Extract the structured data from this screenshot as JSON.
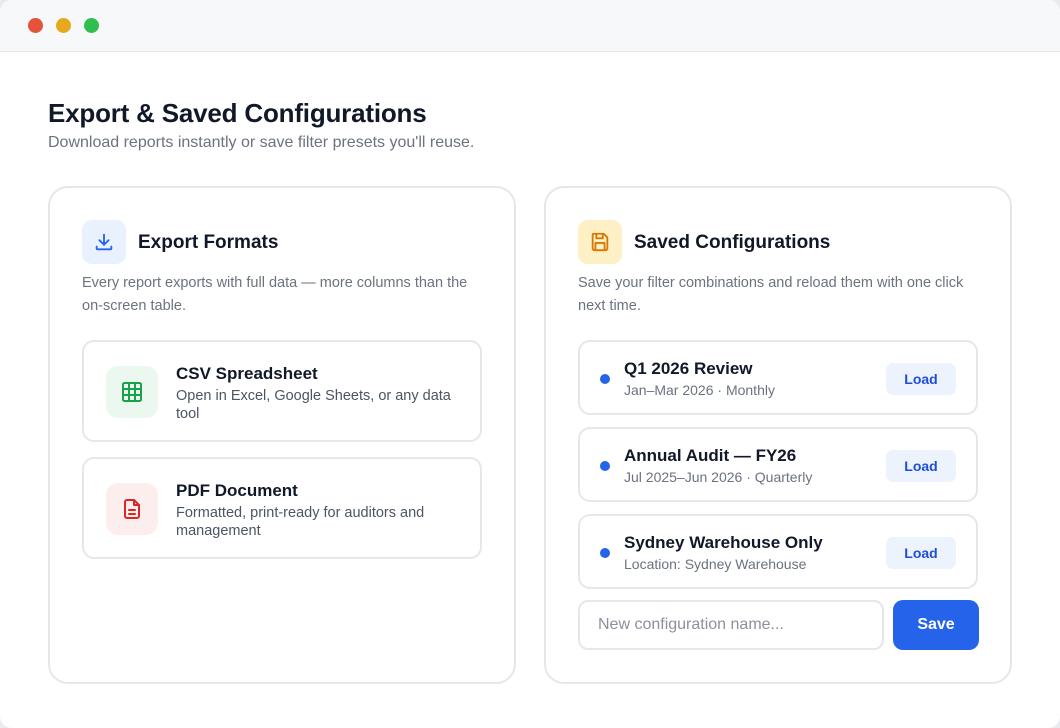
{
  "header": {
    "title": "Export & Saved Configurations",
    "subtitle": "Download reports instantly or save filter presets you'll reuse."
  },
  "export_card": {
    "icon": "download-icon",
    "title": "Export Formats",
    "description": "Every report exports with full data — more columns than the on-screen table.",
    "formats": [
      {
        "icon": "spreadsheet-grid-icon",
        "name": "CSV Spreadsheet",
        "description": "Open in Excel, Google Sheets, or any data tool",
        "accent": "#16a34a"
      },
      {
        "icon": "document-icon",
        "name": "PDF Document",
        "description": "Formatted, print-ready for auditors and management",
        "accent": "#dc2626"
      }
    ]
  },
  "saved_card": {
    "icon": "floppy-disk-icon",
    "title": "Saved Configurations",
    "description": "Save your filter combinations and reload them with one click next time.",
    "configs": [
      {
        "name": "Q1 2026 Review",
        "meta": "Jan–Mar 2026 · Monthly",
        "action": "Load"
      },
      {
        "name": "Annual Audit — FY26",
        "meta": "Jul 2025–Jun 2026 · Quarterly",
        "action": "Load"
      },
      {
        "name": "Sydney Warehouse Only",
        "meta": "Location: Sydney Warehouse",
        "action": "Load"
      }
    ],
    "new_config": {
      "placeholder": "New configuration name...",
      "value": "",
      "save_label": "Save"
    }
  },
  "colors": {
    "primary": "#2563eb",
    "text": "#111827",
    "muted": "#6b7280",
    "border": "#e5e7eb",
    "amber": "#d97706"
  }
}
